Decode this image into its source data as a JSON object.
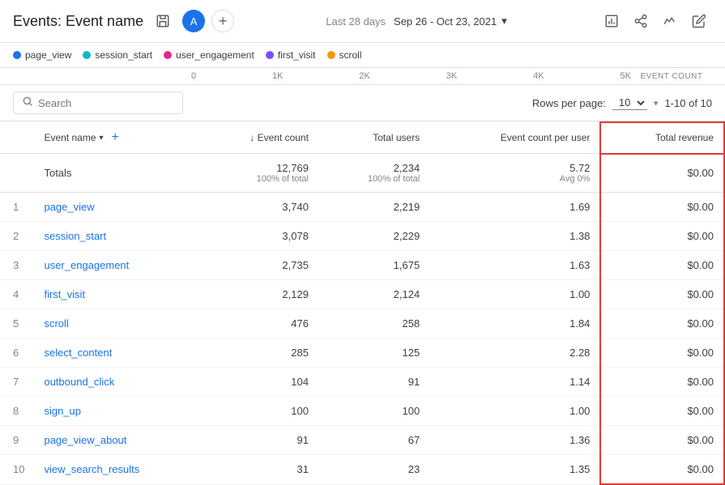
{
  "header": {
    "title": "Events: Event name",
    "avatar_label": "A",
    "date_range_label": "Last 28 days",
    "date_range_value": "Sep 26 - Oct 23, 2021",
    "dropdown_arrow": "▾"
  },
  "legend": {
    "items": [
      {
        "label": "page_view",
        "color": "#1a73e8"
      },
      {
        "label": "session_start",
        "color": "#12b5cb"
      },
      {
        "label": "user_engagement",
        "color": "#e52592"
      },
      {
        "label": "first_visit",
        "color": "#7c4dff"
      },
      {
        "label": "scroll",
        "color": "#f29900"
      }
    ]
  },
  "axis": {
    "labels": [
      {
        "num": "0",
        "name": ""
      },
      {
        "num": "1K",
        "name": ""
      },
      {
        "num": "2K",
        "name": ""
      },
      {
        "num": "3K",
        "name": ""
      },
      {
        "num": "4K",
        "name": ""
      },
      {
        "num": "5K",
        "name": ""
      }
    ],
    "title": "EVENT COUNT"
  },
  "toolbar": {
    "search_placeholder": "Search",
    "rows_per_page_label": "Rows per page:",
    "rows_per_page_value": "10",
    "pagination": "1-10 of 10"
  },
  "table": {
    "columns": [
      {
        "key": "num",
        "label": "",
        "align": "left"
      },
      {
        "key": "event_name",
        "label": "Event name",
        "align": "left",
        "sortable": true,
        "dropdown": true
      },
      {
        "key": "event_count",
        "label": "↓ Event count",
        "align": "right",
        "sorted": true
      },
      {
        "key": "total_users",
        "label": "Total users",
        "align": "right"
      },
      {
        "key": "event_count_per_user",
        "label": "Event count per user",
        "align": "right"
      },
      {
        "key": "total_revenue",
        "label": "Total revenue",
        "align": "right",
        "highlighted": true
      }
    ],
    "totals": {
      "event_count": "12,769",
      "event_count_sub": "100% of total",
      "total_users": "2,234",
      "total_users_sub": "100% of total",
      "event_count_per_user": "5.72",
      "event_count_per_user_sub": "Avg 0%",
      "total_revenue": "$0.00",
      "label": "Totals"
    },
    "rows": [
      {
        "num": 1,
        "event_name": "page_view",
        "event_count": "3,740",
        "total_users": "2,219",
        "event_count_per_user": "1.69",
        "total_revenue": "$0.00"
      },
      {
        "num": 2,
        "event_name": "session_start",
        "event_count": "3,078",
        "total_users": "2,229",
        "event_count_per_user": "1.38",
        "total_revenue": "$0.00"
      },
      {
        "num": 3,
        "event_name": "user_engagement",
        "event_count": "2,735",
        "total_users": "1,675",
        "event_count_per_user": "1.63",
        "total_revenue": "$0.00"
      },
      {
        "num": 4,
        "event_name": "first_visit",
        "event_count": "2,129",
        "total_users": "2,124",
        "event_count_per_user": "1.00",
        "total_revenue": "$0.00"
      },
      {
        "num": 5,
        "event_name": "scroll",
        "event_count": "476",
        "total_users": "258",
        "event_count_per_user": "1.84",
        "total_revenue": "$0.00"
      },
      {
        "num": 6,
        "event_name": "select_content",
        "event_count": "285",
        "total_users": "125",
        "event_count_per_user": "2.28",
        "total_revenue": "$0.00"
      },
      {
        "num": 7,
        "event_name": "outbound_click",
        "event_count": "104",
        "total_users": "91",
        "event_count_per_user": "1.14",
        "total_revenue": "$0.00"
      },
      {
        "num": 8,
        "event_name": "sign_up",
        "event_count": "100",
        "total_users": "100",
        "event_count_per_user": "1.00",
        "total_revenue": "$0.00"
      },
      {
        "num": 9,
        "event_name": "page_view_about",
        "event_count": "91",
        "total_users": "67",
        "event_count_per_user": "1.36",
        "total_revenue": "$0.00"
      },
      {
        "num": 10,
        "event_name": "view_search_results",
        "event_count": "31",
        "total_users": "23",
        "event_count_per_user": "1.35",
        "total_revenue": "$0.00"
      }
    ]
  },
  "icons": {
    "edit": "✏",
    "save": "⊞",
    "share": "⇧",
    "trend": "∿",
    "search": "🔍",
    "dropdown": "▾",
    "add": "+"
  }
}
